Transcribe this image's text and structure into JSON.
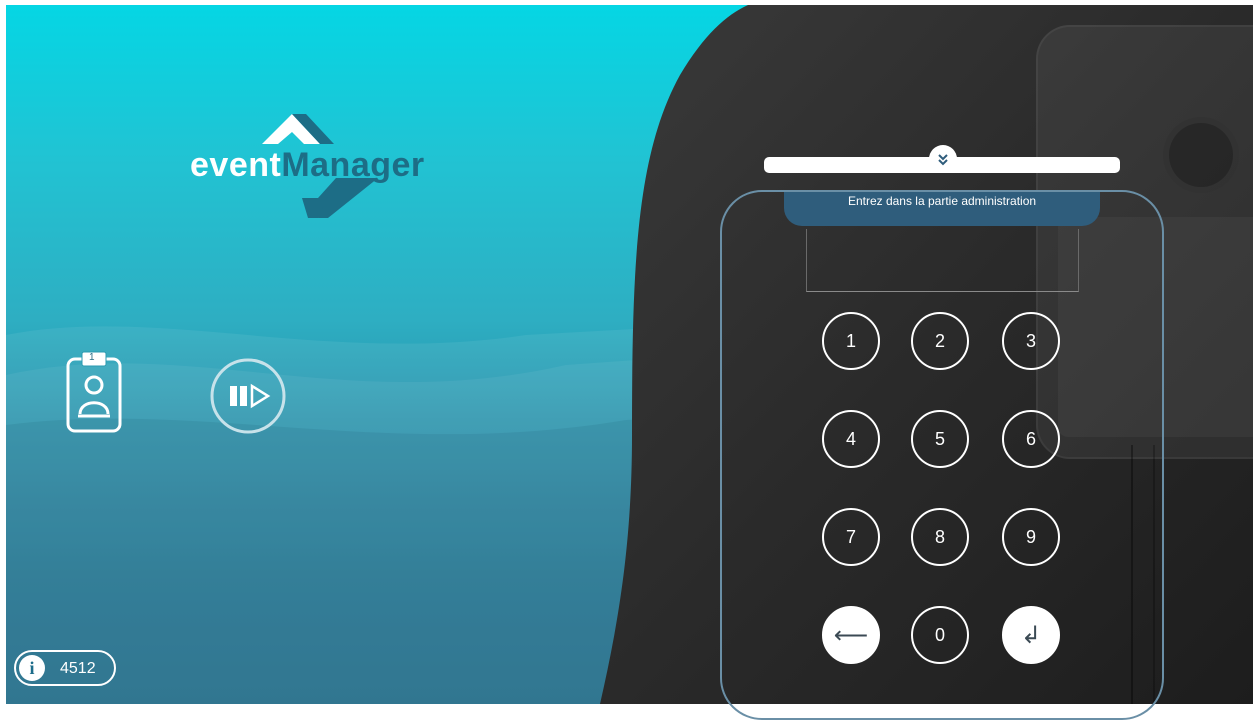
{
  "brand": {
    "word1": "event",
    "word2": "Manager"
  },
  "keypad": {
    "title": "Entrez dans la partie administration",
    "keys": [
      "1",
      "2",
      "3",
      "4",
      "5",
      "6",
      "7",
      "8",
      "9",
      "0"
    ],
    "back_symbol": "⟵",
    "enter_symbol": "↲"
  },
  "info": {
    "icon_letter": "i",
    "value": "4512"
  },
  "badge": {
    "number": "1"
  },
  "colors": {
    "teal_top": "#05d6e4",
    "teal_bottom": "#1a6b89",
    "dark_panel": "#2b2b2b",
    "logo_accent": "#1d6d86"
  }
}
